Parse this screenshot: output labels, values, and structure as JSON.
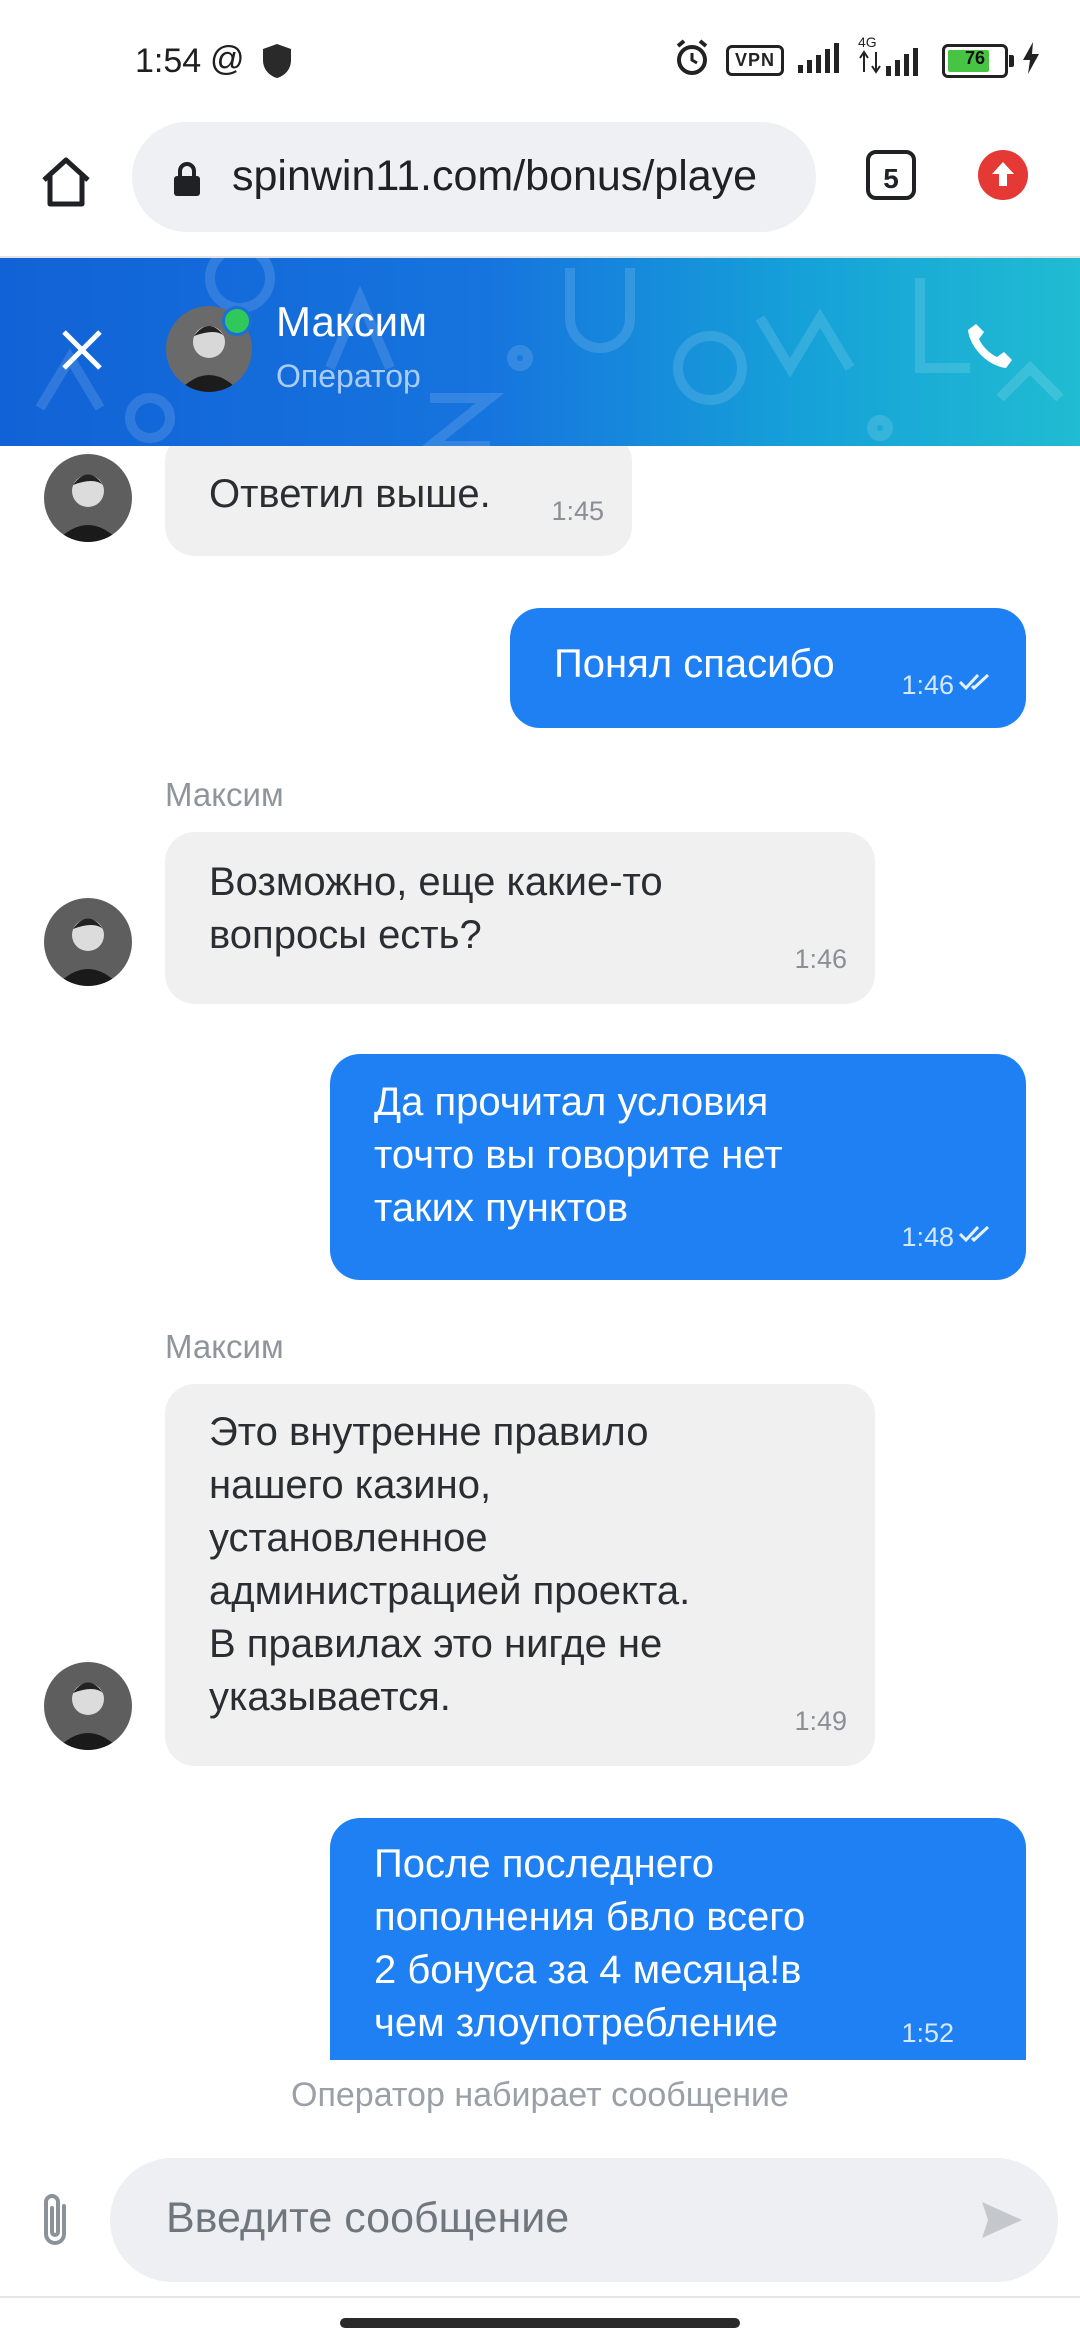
{
  "status_bar": {
    "time": "1:54",
    "at_symbol": "@",
    "vpn": "VPN",
    "network": "4G",
    "battery": "76",
    "battery_level": 0.76,
    "icons": [
      "shield-icon",
      "alarm-icon",
      "signal-icon",
      "charging-icon"
    ]
  },
  "browser": {
    "url": "spinwin11.com/bonus/playe",
    "tabs_count": "5",
    "icons": [
      "home-icon",
      "lock-icon",
      "update-icon"
    ]
  },
  "chat_header": {
    "name": "Максим",
    "role": "Оператор",
    "status_color": "#2fc85a",
    "icons": [
      "close-icon",
      "phone-icon"
    ]
  },
  "messages": [
    {
      "side": "in",
      "text": "Ответил выше.",
      "time": "1:45"
    },
    {
      "side": "out",
      "text": "Понял спасибо",
      "time": "1:46",
      "read": true
    },
    {
      "side": "in",
      "sender": "Максим",
      "text": "Возможно, еще какие-то\nвопросы есть?",
      "time": "1:46"
    },
    {
      "side": "out",
      "text": "Да прочитал условия\nточто вы говорите нет\nтаких пунктов",
      "time": "1:48",
      "read": true
    },
    {
      "side": "in",
      "sender": "Максим",
      "text": "Это внутренне правило\nнашего казино,\nустановленное\nадминистрацией проекта.\nВ правилах это нигде не\nуказывается.",
      "time": "1:49"
    },
    {
      "side": "out",
      "text": "После последнего\nпополнения бвло всего\n2 бонуса за 4 месяца!в\nчем злоупотребление",
      "time": "1:52",
      "read": true
    }
  ],
  "typing_indicator": "Оператор набирает сообщение",
  "composer": {
    "placeholder": "Введите сообщение",
    "icons": [
      "paperclip-icon",
      "send-icon"
    ]
  },
  "colors": {
    "out_bubble": "#1e80f2",
    "in_bubble": "#f0f0f0",
    "header_start": "#1162d6",
    "header_end": "#20bcd2"
  }
}
